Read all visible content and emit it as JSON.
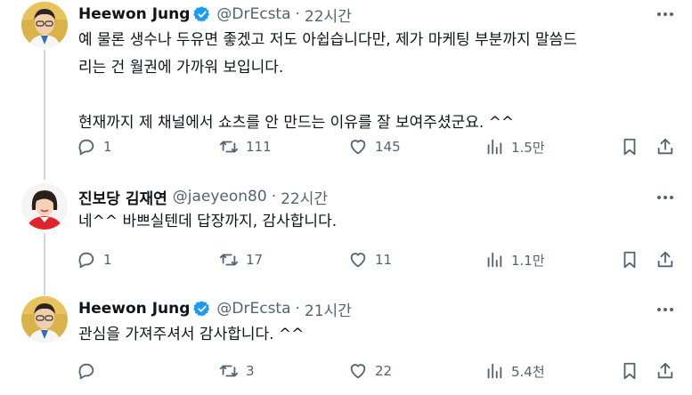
{
  "tweets": [
    {
      "name": "Heewon Jung",
      "verified": true,
      "handle": "@DrEcsta",
      "separator": "·",
      "time": "22시간",
      "text": "예 물론 생수나 두유면 좋겠고 저도 아쉽습니다만, 제가 마케팅 부분까지 말씀드\n리는 건 월권에 가까워 보입니다.\n\n현재까지 제 채널에서 쇼츠를 안 만드는 이유를 잘 보여주셨군요. ^^",
      "replies": "1",
      "retweets": "111",
      "likes": "145",
      "views": "1.5만"
    },
    {
      "name": "진보당 김재연",
      "verified": false,
      "handle": "@jaeyeon80",
      "separator": "·",
      "time": "22시간",
      "text": "네^^ 바쁘실텐데 답장까지, 감사합니다.",
      "replies": "1",
      "retweets": "17",
      "likes": "11",
      "views": "1.1만"
    },
    {
      "name": "Heewon Jung",
      "verified": true,
      "handle": "@DrEcsta",
      "separator": "·",
      "time": "21시간",
      "text": "관심을 가져주셔서 감사합니다. ^^",
      "replies": "",
      "retweets": "3",
      "likes": "22",
      "views": "5.4천"
    }
  ],
  "colors": {
    "text": "#0f1419",
    "secondary": "#536471",
    "verified": "#1d9bf0",
    "thread_line": "#cfd9de"
  },
  "icons": [
    "reply-icon",
    "retweet-icon",
    "like-icon",
    "views-icon",
    "bookmark-icon",
    "share-icon",
    "more-icon",
    "verified-badge-icon"
  ]
}
